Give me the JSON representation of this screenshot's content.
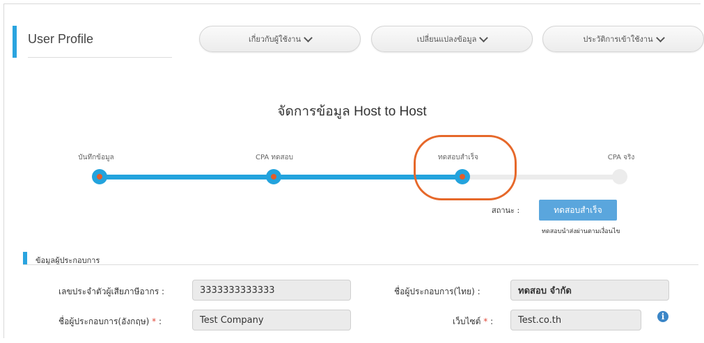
{
  "header": {
    "title": "User Profile",
    "menus": [
      {
        "label": "เกี่ยวกับผู้ใช้งาน"
      },
      {
        "label": "เปลี่ยนแปลงข้อมูล"
      },
      {
        "label": "ประวัติการเข้าใช้งาน"
      }
    ]
  },
  "main": {
    "heading": "จัดการข้อมูล Host to Host",
    "steps": [
      {
        "label": "บันทึกข้อมูล",
        "state": "done"
      },
      {
        "label": "CPA ทดสอบ",
        "state": "done"
      },
      {
        "label": "ทดสอบสำเร็จ",
        "state": "current"
      },
      {
        "label": "CPA จริง",
        "state": "todo"
      }
    ],
    "status": {
      "label": "สถานะ :",
      "badge": "ทดสอบสำเร็จ",
      "note": "ทดสอบนำส่งผ่านตามเงื่อนไข"
    }
  },
  "section": {
    "title": "ข้อมูลผู้ประกอบการ",
    "fields": {
      "tax_id": {
        "label": "เลขประจำตัวผู้เสียภาษีอากร :",
        "value": "3333333333333"
      },
      "name_th": {
        "label": "ชื่อผู้ประกอบการ(ไทย) :",
        "value": "ทดสอบ จำกัด"
      },
      "name_en": {
        "label": "ชื่อผู้ประกอบการ(อังกฤษ)",
        "required": "*",
        "suffix": ":",
        "value": "Test Company"
      },
      "website": {
        "label": "เว็บไซต์",
        "required": "*",
        "suffix": ":",
        "value": "Test.co.th"
      }
    }
  },
  "colors": {
    "accent": "#23a3dd",
    "highlight": "#e6682a",
    "node_dot": "#e35d2a",
    "badge": "#5aa6dd"
  },
  "icons": {
    "menu": "chevron-down-icon",
    "info": "info-icon"
  }
}
